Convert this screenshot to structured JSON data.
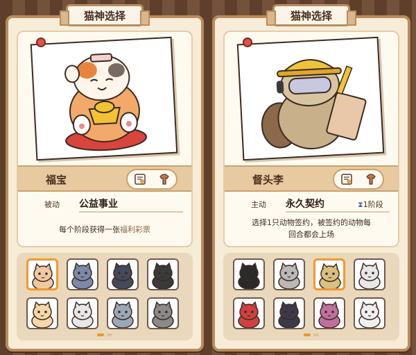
{
  "colors": {
    "accent": "#e9962f",
    "panel": "#f6ecd7",
    "border": "#b98b5c",
    "name_bar": "#e8caa0"
  },
  "panels": [
    {
      "title": "猫神选择",
      "name": "福宝",
      "skill_type": "被动",
      "skill_name": "公益事业",
      "stage": "",
      "desc_line1": "每个阶段获得一张",
      "desc_highlight": "福利彩票",
      "desc_line2": "",
      "icons": [
        "certificate-icon",
        "shirt-icon"
      ],
      "selected_index": 0,
      "page": 1,
      "pages": 2,
      "cat_colors": [
        "#f0c9a0",
        "#7a8aa8",
        "#444a5a",
        "#3a3a3a",
        "#f5d8a8",
        "#e8e8e8",
        "#9aa8b8",
        "#8a8a8a"
      ]
    },
    {
      "title": "猫神选择",
      "name": "督头李",
      "skill_type": "主动",
      "skill_name": "永久契约",
      "stage": "1阶段",
      "desc_line1": "选择1只动物签约，被签约的动物每",
      "desc_highlight": "",
      "desc_line2": "回合都会上场",
      "icons": [
        "contract-icon",
        "shirt-icon"
      ],
      "selected_index": 2,
      "page": 1,
      "pages": 2,
      "cat_colors": [
        "#2a2a2a",
        "#b8b8b8",
        "#d8c080",
        "#e8e8e8",
        "#d04040",
        "#3a3a4a",
        "#c070a0",
        "#f0f0f0"
      ]
    }
  ]
}
